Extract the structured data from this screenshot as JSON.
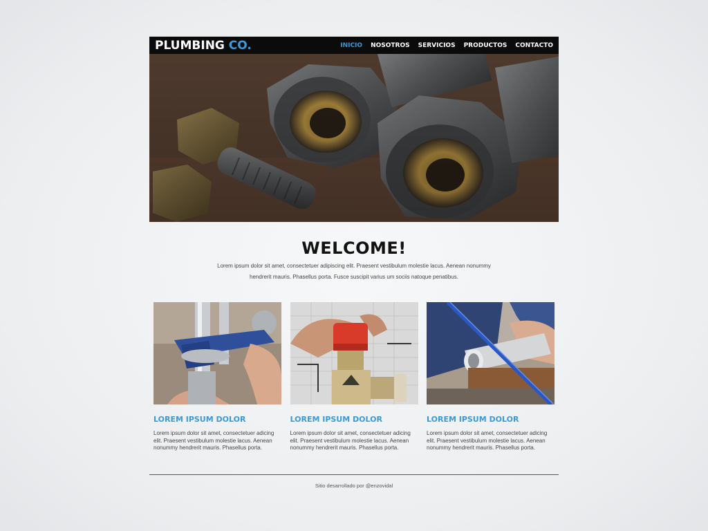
{
  "header": {
    "logo_main": "PLUMBING",
    "logo_accent": "CO.",
    "nav": [
      {
        "label": "INICIO",
        "active": true
      },
      {
        "label": "NOSOTROS",
        "active": false
      },
      {
        "label": "SERVICIOS",
        "active": false
      },
      {
        "label": "PRODUCTOS",
        "active": false
      },
      {
        "label": "CONTACTO",
        "active": false
      }
    ]
  },
  "welcome": {
    "title": "WELCOME!",
    "text": "Lorem ipsum dolor sit amet, consectetuer adipiscing elit. Praesent vestibulum molestie lacus. Aenean nonummy hendrerit mauris. Phasellus porta. Fusce suscipit varius um sociis natoque penatibus."
  },
  "cards": [
    {
      "title": "LOREM IPSUM DOLOR",
      "text": "Lorem ipsum dolor sit amet, consectetuer adicing elit. Praesent vestibulum molestie lacus. Aenean nonummy hendrerit mauris. Phasellus porta."
    },
    {
      "title": "LOREM IPSUM DOLOR",
      "text": "Lorem ipsum dolor sit amet, consectetuer adicing elit. Praesent vestibulum molestie lacus. Aenean nonummy hendrerit mauris. Phasellus porta."
    },
    {
      "title": "LOREM IPSUM DOLOR",
      "text": "Lorem ipsum dolor sit amet, consectetuer adicing elit. Praesent vestibulum molestie lacus. Aenean nonummy hendrerit mauris. Phasellus porta."
    }
  ],
  "footer": {
    "text": "Sitio desarrollado por @enzovidal"
  },
  "colors": {
    "accent": "#3a9ad9",
    "topbar": "#0b0b0b"
  }
}
